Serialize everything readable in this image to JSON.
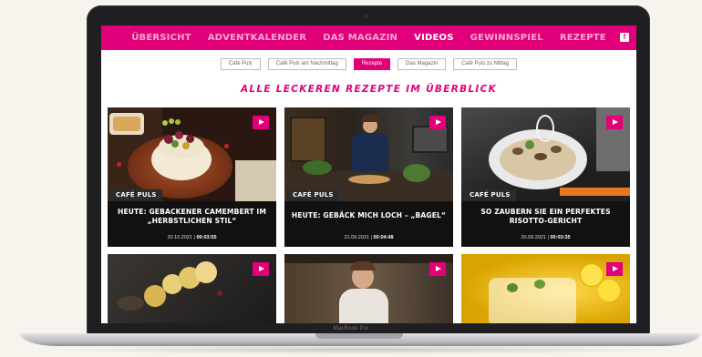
{
  "device": {
    "brand_label": "MacBook Pro"
  },
  "topnav": {
    "items": [
      {
        "label": "ÜBERSICHT",
        "active": false
      },
      {
        "label": "ADVENTKALENDER",
        "active": false
      },
      {
        "label": "DAS MAGAZIN",
        "active": false
      },
      {
        "label": "VIDEOS",
        "active": true
      },
      {
        "label": "GEWINNSPIEL",
        "active": false
      },
      {
        "label": "REZEPTE",
        "active": false
      }
    ],
    "social_icon": "f"
  },
  "subnav": {
    "pills": [
      {
        "label": "Café Puls",
        "active": false
      },
      {
        "label": "Café Puls am Nachmittag",
        "active": false
      },
      {
        "label": "Rezepte",
        "active": true
      },
      {
        "label": "Das Magazin",
        "active": false
      },
      {
        "label": "Café Puls zu Mittag",
        "active": false
      }
    ]
  },
  "headline": "ALLE LECKEREN REZEPTE IM ÜBERBLICK",
  "cards": [
    {
      "badge": "CAFÉ PULS",
      "title": "HEUTE: GEBACKENER CAMEMBERT IM „HERBSTLICHEN STIL“",
      "date": "20.10.2021",
      "duration": "00:03:55"
    },
    {
      "badge": "CAFÉ PULS",
      "title": "HEUTE: GEBÄCK MICH LOCH – „BAGEL“",
      "date": "21.09.2021",
      "duration": "00:04:48"
    },
    {
      "badge": "CAFÉ PULS",
      "title": "SO ZAUBERN SIE EIN PERFEKTES RISOTTO-GERICHT",
      "date": "20.09.2021",
      "duration": "00:03:35"
    }
  ],
  "colors": {
    "accent": "#e2007a",
    "card_bg": "#111111"
  }
}
